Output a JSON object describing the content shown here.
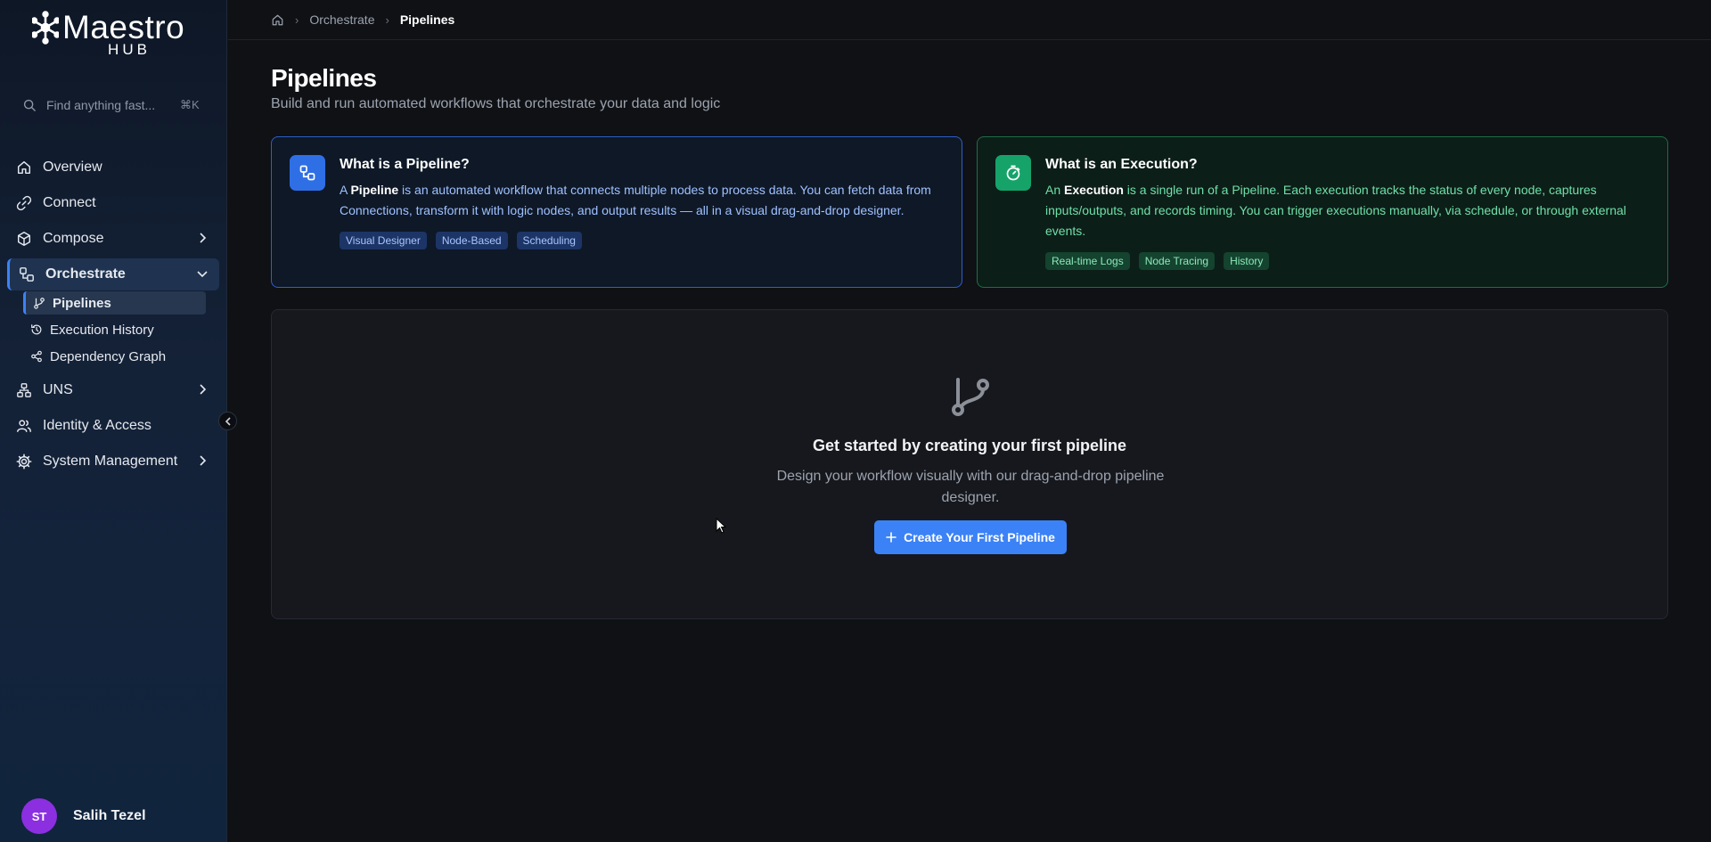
{
  "brand": {
    "name": "Maestro",
    "sub": "HUB"
  },
  "search": {
    "placeholder": "Find anything fast...",
    "shortcut": "⌘K"
  },
  "nav": {
    "overview": "Overview",
    "connect": "Connect",
    "compose": "Compose",
    "orchestrate": "Orchestrate",
    "sub": {
      "pipelines": "Pipelines",
      "execution_history": "Execution History",
      "dependency_graph": "Dependency Graph"
    },
    "uns": "UNS",
    "identity": "Identity & Access",
    "system": "System Management"
  },
  "user": {
    "initials": "ST",
    "name": "Salih Tezel"
  },
  "breadcrumb": {
    "section": "Orchestrate",
    "current": "Pipelines"
  },
  "page": {
    "title": "Pipelines",
    "subtitle": "Build and run automated workflows that orchestrate your data and logic"
  },
  "card_pipeline": {
    "title": "What is a Pipeline?",
    "text_a": "A ",
    "text_bold": "Pipeline",
    "text_b": " is an automated workflow that connects multiple nodes to process data. You can fetch data from Connections, transform it with logic nodes, and output results — all in a visual drag-and-drop designer.",
    "tags": [
      "Visual Designer",
      "Node-Based",
      "Scheduling"
    ]
  },
  "card_execution": {
    "title": "What is an Execution?",
    "text_a": "An ",
    "text_bold": "Execution",
    "text_b": " is a single run of a Pipeline. Each execution tracks the status of every node, captures inputs/outputs, and records timing. You can trigger executions manually, via schedule, or through external events.",
    "tags": [
      "Real-time Logs",
      "Node Tracing",
      "History"
    ]
  },
  "empty": {
    "title": "Get started by creating your first pipeline",
    "description": "Design your workflow visually with our drag-and-drop pipeline designer.",
    "button": "Create Your First Pipeline"
  },
  "colors": {
    "accent": "#3b82f6",
    "success": "#16a36a",
    "avatar": "#8b2fe0"
  }
}
